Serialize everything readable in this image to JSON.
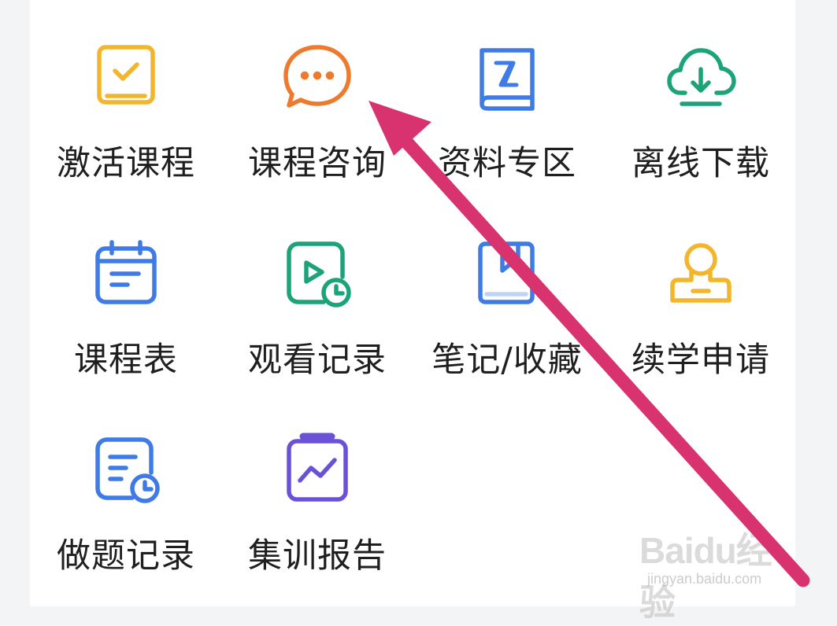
{
  "menu": {
    "items": [
      {
        "label": "激活课程",
        "icon": "activate-course-icon"
      },
      {
        "label": "课程咨询",
        "icon": "chat-bubble-icon"
      },
      {
        "label": "资料专区",
        "icon": "book-icon"
      },
      {
        "label": "离线下载",
        "icon": "cloud-download-icon"
      },
      {
        "label": "课程表",
        "icon": "calendar-icon"
      },
      {
        "label": "观看记录",
        "icon": "video-history-icon"
      },
      {
        "label": "笔记/收藏",
        "icon": "notebook-icon"
      },
      {
        "label": "续学申请",
        "icon": "user-stamp-icon"
      },
      {
        "label": "做题记录",
        "icon": "exercise-history-icon"
      },
      {
        "label": "集训报告",
        "icon": "report-chart-icon"
      }
    ]
  },
  "watermark": {
    "brand": "Baidu经验",
    "url": "jingyan.baidu.com"
  },
  "colors": {
    "yellow": "#F3B52C",
    "orange": "#EE7A2D",
    "blue": "#3F7BE6",
    "green": "#1DA37A",
    "purple": "#6B50D8",
    "arrow": "#D8336F"
  }
}
